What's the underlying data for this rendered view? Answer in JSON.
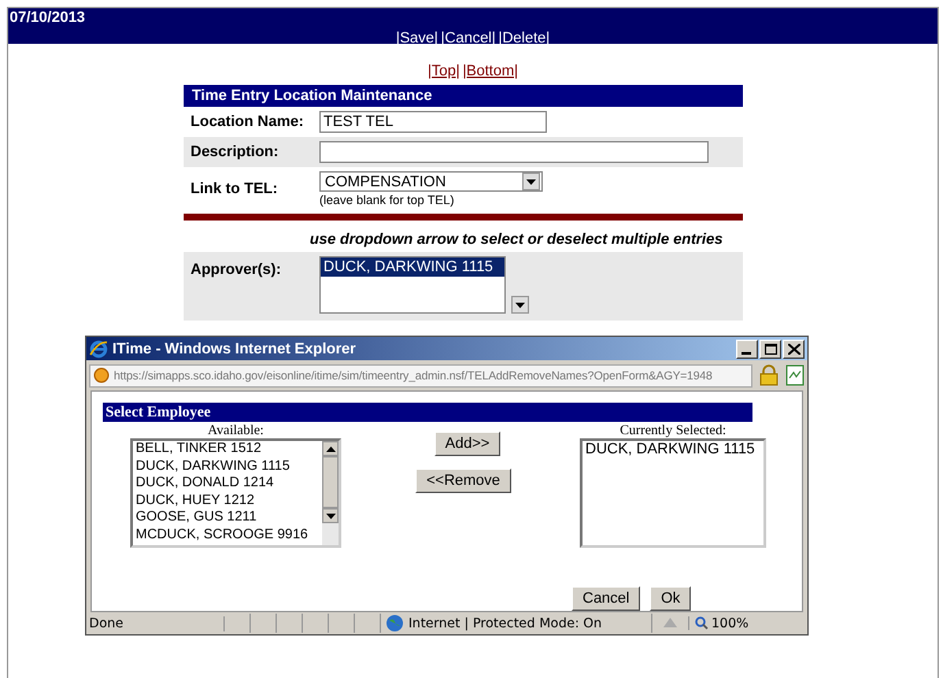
{
  "header": {
    "date": "07/10/2013",
    "actions": [
      "|Save|",
      "|Cancel|",
      "|Delete|"
    ]
  },
  "page_links": [
    "|Top|",
    "|Bottom|"
  ],
  "form": {
    "title": "Time Entry Location Maintenance",
    "location_name": {
      "label": "Location Name:",
      "value": "TEST TEL"
    },
    "description": {
      "label": "Description:"
    },
    "link_to_tel": {
      "label": "Link to TEL:",
      "value": "COMPENSATION",
      "hint": "(leave blank for top TEL)"
    },
    "approver_hint": "use dropdown arrow to select or deselect multiple entries",
    "approvers": {
      "label": "Approver(s):",
      "items": [
        {
          "text": "DUCK, DARKWING 1115",
          "selected": true
        }
      ]
    }
  },
  "popup": {
    "title": "ITime - Windows Internet Explorer",
    "url": "https://simapps.sco.idaho.gov/eisonline/itime/sim/timeentry_admin.nsf/TELAddRemoveNames?OpenForm&AGY=1948",
    "section_title": "Select Employee",
    "available": {
      "label": "Available:",
      "items": [
        "BELL, TINKER 1512",
        "DUCK, DARKWING 1115",
        "DUCK, DONALD 1214",
        "DUCK, HUEY 1212",
        "GOOSE, GUS 1211",
        "MCDUCK, SCROOGE 9916"
      ]
    },
    "add_button": "Add>>",
    "remove_button": "<<Remove",
    "selected": {
      "label": "Currently Selected:",
      "items": [
        "DUCK, DARKWING 1115"
      ]
    },
    "buttons": [
      "Cancel",
      "Ok"
    ],
    "status": {
      "text": "Done",
      "zone": "Internet | Protected Mode: On",
      "zoom": "100%"
    }
  }
}
